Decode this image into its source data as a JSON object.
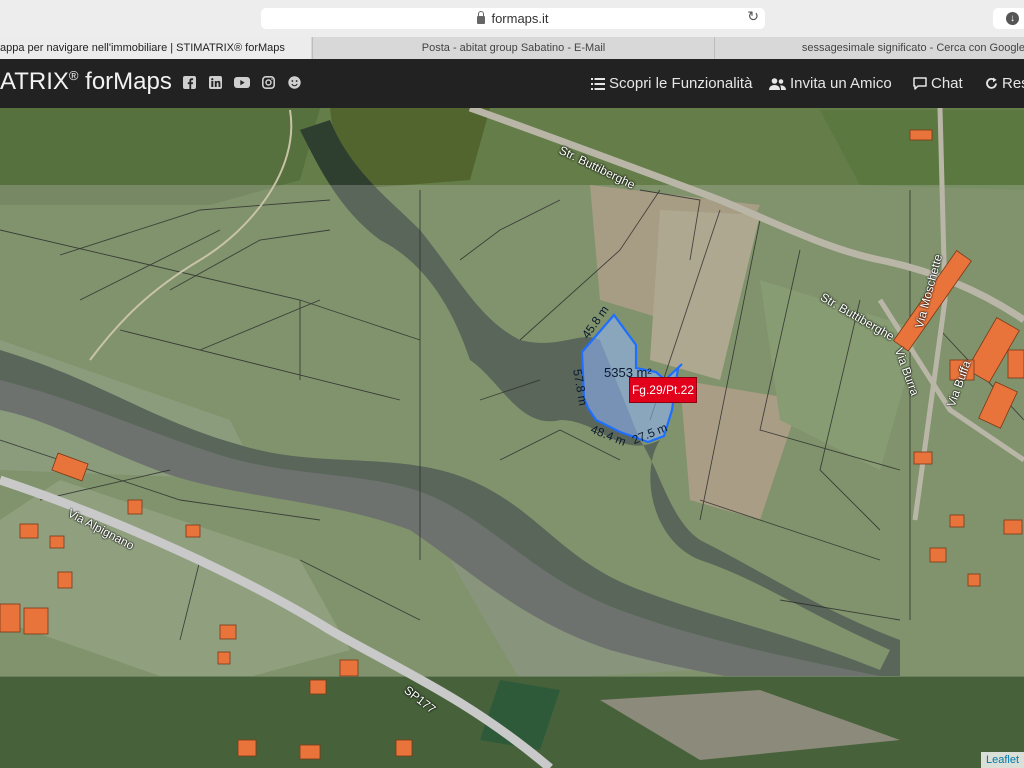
{
  "browser": {
    "url": "formaps.it",
    "tabs": [
      {
        "label": "appa per navigare nell'immobiliare | STIMATRIX® forMaps",
        "active": true
      },
      {
        "label": "Posta - abitat group Sabatino - E-Mail",
        "active": false
      },
      {
        "label": "sessagesimale significato - Cerca con Google",
        "active": false
      }
    ]
  },
  "nav": {
    "brand_prefix": "ATRIX",
    "brand_reg": "®",
    "brand_suffix": " forMaps",
    "social_icons": [
      "facebook-icon",
      "linkedin-icon",
      "youtube-icon",
      "instagram-icon",
      "smile-icon"
    ],
    "links": [
      {
        "label": "Scopri le Funzionalità",
        "icon": "list-icon"
      },
      {
        "label": "Invita un Amico",
        "icon": "users-icon"
      },
      {
        "label": "Chat",
        "icon": "chat-icon"
      },
      {
        "label": "Res",
        "icon": "refresh-icon"
      }
    ]
  },
  "map": {
    "parcel_label": "Fg.29/Pt.22",
    "area_label": "5353 m²",
    "dimensions": [
      "45.8 m",
      "57.8 m",
      "48.4 m",
      "27.5 m"
    ],
    "roads": [
      "Str. Buttiberghe",
      "Str. Buttiberghe",
      "Via Moschette",
      "Via Buffa",
      "Via Burra",
      "Via Alpignano",
      "SP177"
    ],
    "attribution": "Leaflet",
    "colors": {
      "parcel_stroke": "#1e6fff",
      "parcel_fill": "#8fb6ff",
      "parcel_label_bg": "#e3001b",
      "buildings": "#e8743b",
      "nav_bg": "#222222"
    }
  }
}
